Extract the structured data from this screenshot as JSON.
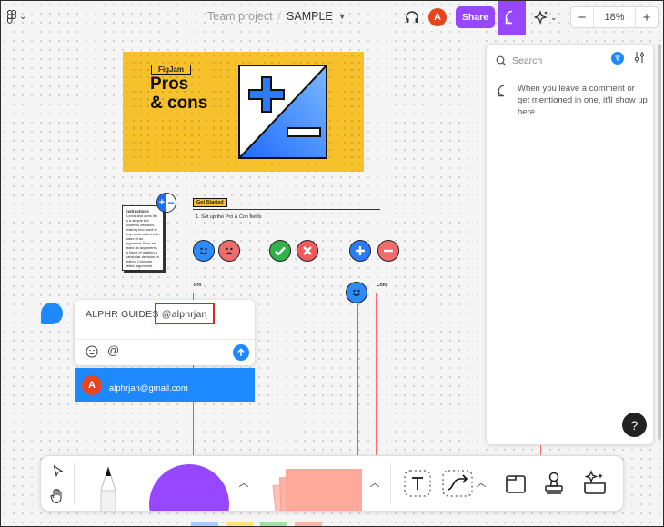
{
  "topbar": {
    "team": "Team project",
    "separator": "/",
    "file_name": "SAMPLE",
    "avatar_initial": "A",
    "share_label": "Share",
    "zoom_out": "−",
    "zoom_level": "18%",
    "zoom_in": "+"
  },
  "canvas": {
    "banner_badge": "FigJam",
    "banner_title": "Pros\n& cons",
    "instructions_title": "Instructions",
    "instructions_text": "A pros and cons list is a simple but powerful decision-making tool used to help understand both sides of an argument. Pros are listed as arguments in favor of making a particular decision or action. Cons are listed arguments against it.",
    "get_started": "Get Started",
    "step_1": "1. Set up the Pro & Con fields",
    "pro_label": "Pro",
    "con_label": "Cons"
  },
  "comment_composer": {
    "text_before": "ALPHR GUIDES ",
    "mention": "@alphrjan",
    "at_symbol": "@",
    "suggestion_initial": "A",
    "suggestion_email": "alphrjan@gmail.com"
  },
  "comments_panel": {
    "search_placeholder": "Search",
    "empty_message": "When you leave a comment or get mentioned in one, it'll show up here.",
    "help_label": "?"
  },
  "colors": {
    "accent_purple": "#9747ff",
    "accent_blue": "#1e88ff",
    "avatar_red": "#e5461e",
    "banner_yellow": "#f7c12b"
  }
}
